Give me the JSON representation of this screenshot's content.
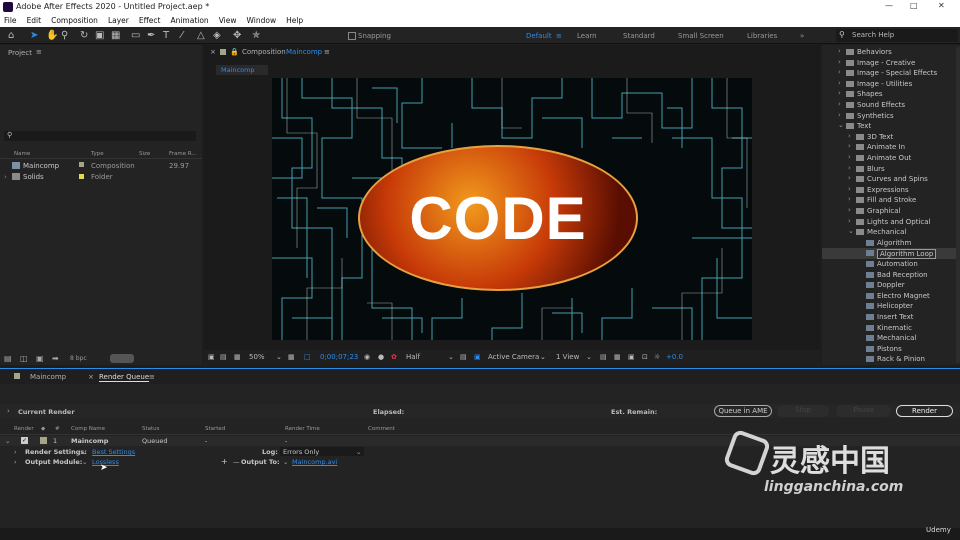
{
  "app": {
    "title": "Adobe After Effects 2020 - Untitled Project.aep *"
  },
  "menu": [
    "File",
    "Edit",
    "Composition",
    "Layer",
    "Effect",
    "Animation",
    "View",
    "Window",
    "Help"
  ],
  "toolbar": {
    "snapping": "Snapping",
    "workspaces": [
      "Default",
      "Learn",
      "Standard",
      "Small Screen",
      "Libraries"
    ],
    "search": "Search Help"
  },
  "project": {
    "title": "Project",
    "columns": [
      "Name",
      "Type",
      "Size",
      "Frame R..."
    ],
    "items": [
      {
        "name": "Maincomp",
        "type": "Composition",
        "fr": "29.97"
      },
      {
        "name": "Solids",
        "type": "Folder",
        "fr": ""
      }
    ],
    "bpc": "8 bpc"
  },
  "viewer": {
    "panel": "Composition",
    "comp": "Maincomp",
    "tab": "Maincomp",
    "zoom": "50%",
    "time": "0;00;07;23",
    "res": "Half",
    "camera": "Active Camera",
    "view": "1 View",
    "exposure": "+0.0",
    "text": "CODE"
  },
  "effects": {
    "items": [
      {
        "label": "Behaviors",
        "lvl": 1,
        "folder": true,
        "open": false
      },
      {
        "label": "Image - Creative",
        "lvl": 1,
        "folder": true,
        "open": false
      },
      {
        "label": "Image - Special Effects",
        "lvl": 1,
        "folder": true,
        "open": false
      },
      {
        "label": "Image - Utilities",
        "lvl": 1,
        "folder": true,
        "open": false
      },
      {
        "label": "Shapes",
        "lvl": 1,
        "folder": true,
        "open": false
      },
      {
        "label": "Sound Effects",
        "lvl": 1,
        "folder": true,
        "open": false
      },
      {
        "label": "Synthetics",
        "lvl": 1,
        "folder": true,
        "open": false
      },
      {
        "label": "Text",
        "lvl": 1,
        "folder": true,
        "open": true
      },
      {
        "label": "3D Text",
        "lvl": 2,
        "folder": true,
        "open": false
      },
      {
        "label": "Animate In",
        "lvl": 2,
        "folder": true,
        "open": false
      },
      {
        "label": "Animate Out",
        "lvl": 2,
        "folder": true,
        "open": false
      },
      {
        "label": "Blurs",
        "lvl": 2,
        "folder": true,
        "open": false
      },
      {
        "label": "Curves and Spins",
        "lvl": 2,
        "folder": true,
        "open": false
      },
      {
        "label": "Expressions",
        "lvl": 2,
        "folder": true,
        "open": false
      },
      {
        "label": "Fill and Stroke",
        "lvl": 2,
        "folder": true,
        "open": false
      },
      {
        "label": "Graphical",
        "lvl": 2,
        "folder": true,
        "open": false
      },
      {
        "label": "Lights and Optical",
        "lvl": 2,
        "folder": true,
        "open": false
      },
      {
        "label": "Mechanical",
        "lvl": 2,
        "folder": true,
        "open": true
      },
      {
        "label": "Algorithm",
        "lvl": 3,
        "folder": false
      },
      {
        "label": "Algorithm Loop",
        "lvl": 3,
        "folder": false,
        "selected": true
      },
      {
        "label": "Automation",
        "lvl": 3,
        "folder": false
      },
      {
        "label": "Bad Reception",
        "lvl": 3,
        "folder": false
      },
      {
        "label": "Doppler",
        "lvl": 3,
        "folder": false
      },
      {
        "label": "Electro Magnet",
        "lvl": 3,
        "folder": false
      },
      {
        "label": "Helicopter",
        "lvl": 3,
        "folder": false
      },
      {
        "label": "Insert Text",
        "lvl": 3,
        "folder": false
      },
      {
        "label": "Kinematic",
        "lvl": 3,
        "folder": false
      },
      {
        "label": "Mechanical",
        "lvl": 3,
        "folder": false
      },
      {
        "label": "Pistons",
        "lvl": 3,
        "folder": false
      },
      {
        "label": "Rack & Pinion",
        "lvl": 3,
        "folder": false
      }
    ]
  },
  "timeline": {
    "tabs": [
      "Maincomp",
      "Render Queue"
    ],
    "current_render": "Current Render",
    "elapsed": "Elapsed:",
    "remain": "Est. Remain:",
    "queue_ame": "Queue in AME",
    "stop": "Stop",
    "pause": "Pause",
    "render": "Render",
    "cols": [
      "Render",
      "#",
      "Comp Name",
      "Status",
      "Started",
      "Render Time",
      "Comment"
    ],
    "row": {
      "num": "1",
      "comp": "Maincomp",
      "status": "Queued",
      "started": "-",
      "time": "-"
    },
    "render_settings_lbl": "Render Settings:",
    "render_settings": "Best Settings",
    "log_lbl": "Log:",
    "log": "Errors Only",
    "output_module_lbl": "Output Module:",
    "output_module": "Lossless",
    "output_to_lbl": "Output To:",
    "output_to": "Maincomp.avi"
  },
  "watermark": {
    "cn": "灵感中国",
    "url": "lingganchina.com",
    "udemy": "Udemy"
  }
}
